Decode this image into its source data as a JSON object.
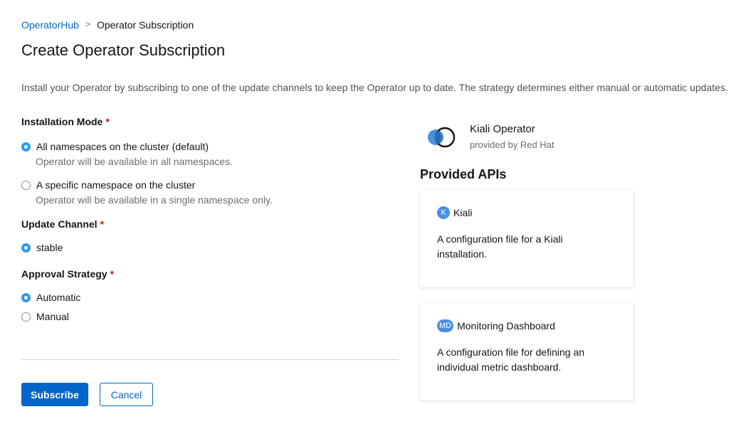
{
  "breadcrumb": {
    "link": "OperatorHub",
    "separator": ">",
    "current": "Operator Subscription"
  },
  "page": {
    "title": "Create Operator Subscription",
    "description": "Install your Operator by subscribing to one of the update channels to keep the Operator up to date. The strategy determines either manual or automatic updates."
  },
  "form": {
    "required_marker": "*",
    "installation_mode": {
      "label": "Installation Mode",
      "options": [
        {
          "label": "All namespaces on the cluster (default)",
          "help": "Operator will be available in all namespaces.",
          "checked": true
        },
        {
          "label": "A specific namespace on the cluster",
          "help": "Operator will be available in a single namespace only.",
          "checked": false
        }
      ]
    },
    "update_channel": {
      "label": "Update Channel",
      "options": [
        {
          "label": "stable",
          "checked": true
        }
      ]
    },
    "approval_strategy": {
      "label": "Approval Strategy",
      "options": [
        {
          "label": "Automatic",
          "checked": true
        },
        {
          "label": "Manual",
          "checked": false
        }
      ]
    }
  },
  "actions": {
    "subscribe": "Subscribe",
    "cancel": "Cancel"
  },
  "operator": {
    "name": "Kiali Operator",
    "provider": "provided by Red Hat",
    "icon": "kiali-logo-icon"
  },
  "provided_apis": {
    "title": "Provided APIs",
    "items": [
      {
        "badge": "K",
        "name": "Kiali",
        "description": "A configuration file for a Kiali installation."
      },
      {
        "badge": "MD",
        "name": "Monitoring Dashboard",
        "description": "A configuration file for defining an individual metric dashboard."
      }
    ]
  },
  "colors": {
    "link": "#0066cc",
    "primary_button": "#0066cc",
    "radio_checked": "#2b9af3",
    "required": "#c9190b",
    "badge": "#4a90e2"
  }
}
